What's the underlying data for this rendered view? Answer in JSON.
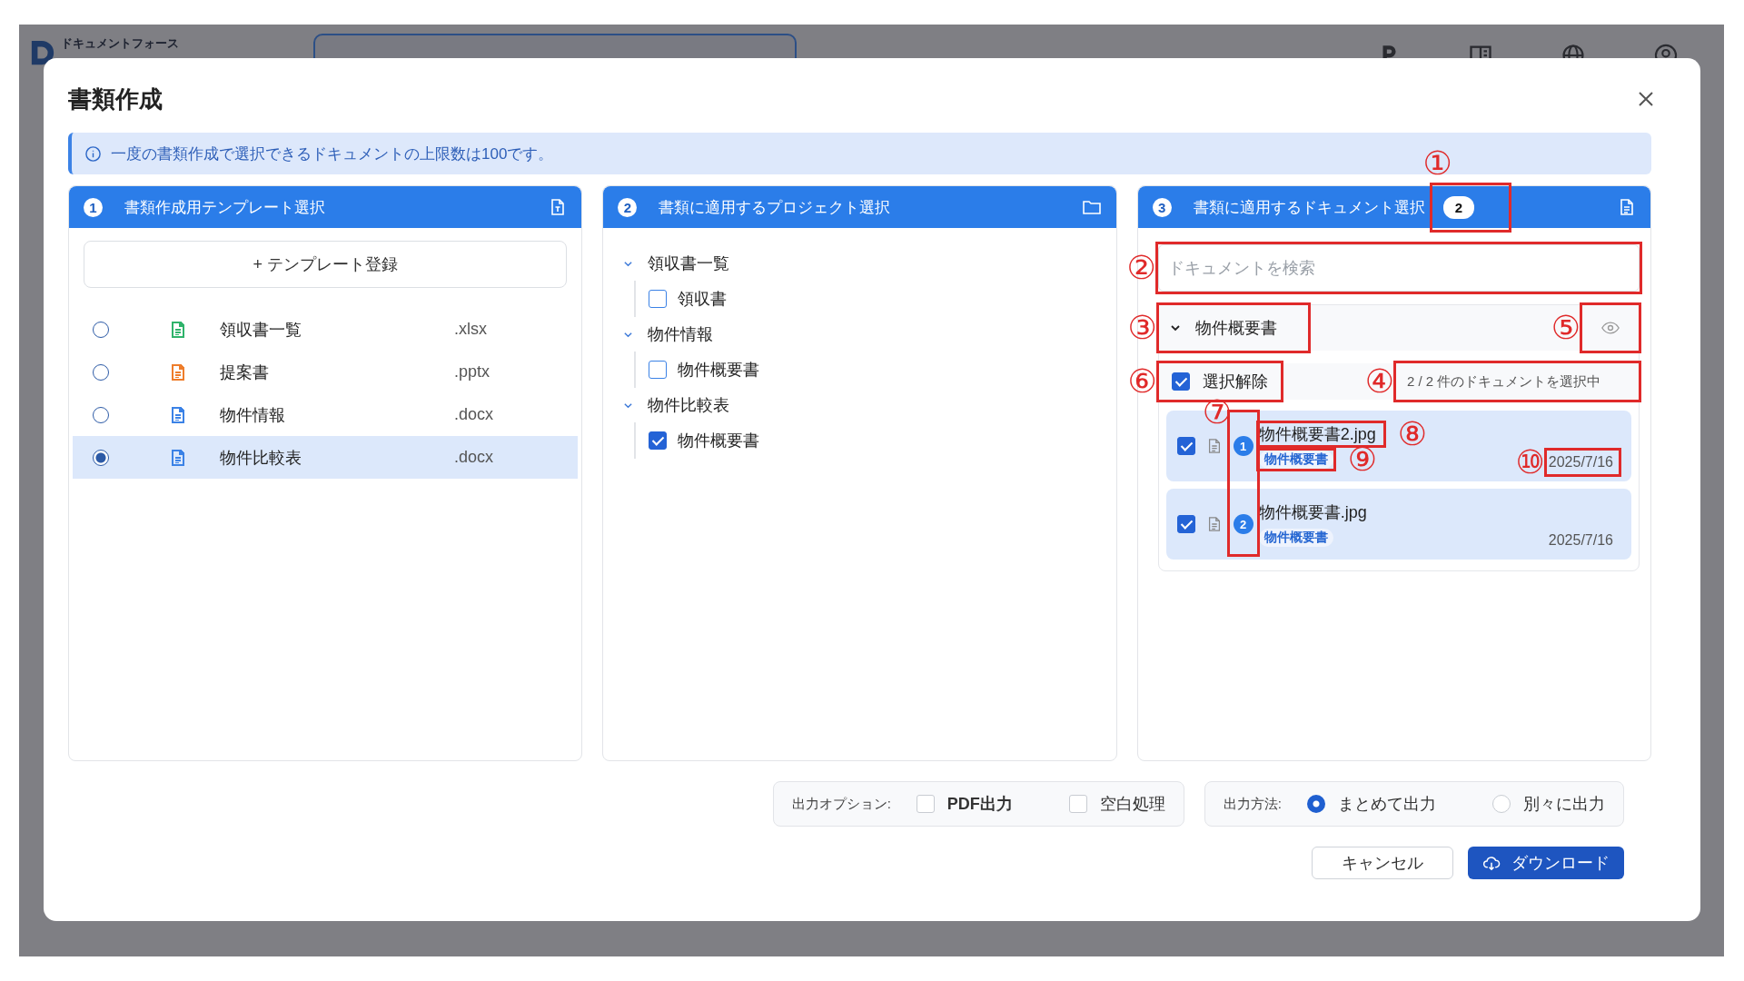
{
  "app": {
    "logo_text": "ドキュメントフォース"
  },
  "dialog": {
    "title": "書類作成",
    "info": "一度の書類作成で選択できるドキュメントの上限数は100です。"
  },
  "template_panel": {
    "step": "1",
    "title": "書類作成用テンプレート選択",
    "add_button": "+ テンプレート登録",
    "templates": [
      {
        "name": "領収書一覧",
        "ext": ".xlsx",
        "color": "#2fb36b",
        "selected": false
      },
      {
        "name": "提案書",
        "ext": ".pptx",
        "color": "#ee7d2b",
        "selected": false
      },
      {
        "name": "物件情報",
        "ext": ".docx",
        "color": "#3b82e6",
        "selected": false
      },
      {
        "name": "物件比較表",
        "ext": ".docx",
        "color": "#3b82e6",
        "selected": true
      }
    ]
  },
  "project_panel": {
    "step": "2",
    "title": "書類に適用するプロジェクト選択",
    "groups": [
      {
        "label": "領収書一覧",
        "expanded": true,
        "children": [
          {
            "label": "領収書",
            "checked": false
          }
        ]
      },
      {
        "label": "物件情報",
        "expanded": true,
        "children": [
          {
            "label": "物件概要書",
            "checked": false
          }
        ]
      },
      {
        "label": "物件比較表",
        "expanded": true,
        "children": [
          {
            "label": "物件概要書",
            "checked": true
          }
        ]
      }
    ]
  },
  "document_panel": {
    "step": "3",
    "title": "書類に適用するドキュメント選択",
    "count": {
      "text": "2",
      "callout": "①"
    },
    "search": {
      "placeholder": "ドキュメントを検索",
      "callout": "②"
    },
    "group": {
      "label": "物件概要書",
      "expanded": true,
      "callout": "③",
      "preview_callout": "⑤"
    },
    "select_all": {
      "label": "選択解除",
      "checked": true,
      "callout": "⑥"
    },
    "selection_status": {
      "text": "2 / 2 件のドキュメントを選択中",
      "callout": "④"
    },
    "order_callout": "⑦",
    "documents": [
      {
        "order": "1",
        "name": "物件概要書2.jpg",
        "tag": "物件概要書",
        "date": "2025/7/16",
        "checked": true,
        "name_callout": "⑧",
        "tag_callout": "⑨",
        "date_callout": "⑩"
      },
      {
        "order": "2",
        "name": "物件概要書.jpg",
        "tag": "物件概要書",
        "date": "2025/7/16",
        "checked": true
      }
    ]
  },
  "output_options": {
    "label": "出力オプション:",
    "options": [
      {
        "label": "PDF出力",
        "checked": false
      },
      {
        "label": "空白処理",
        "checked": false
      }
    ]
  },
  "output_method": {
    "label": "出力方法:",
    "options": [
      {
        "label": "まとめて出力",
        "selected": true
      },
      {
        "label": "別々に出力",
        "selected": false
      }
    ]
  },
  "buttons": [
    {
      "label": "キャンセル",
      "kind": "secondary"
    },
    {
      "label": "ダウンロード",
      "kind": "primary"
    }
  ]
}
